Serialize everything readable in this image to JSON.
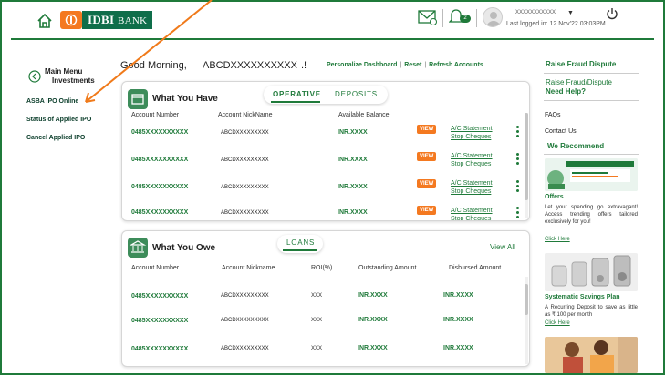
{
  "header": {
    "logo_text": "IDBI",
    "logo_suffix": "BANK",
    "notification_count": "2",
    "user_name": "XXXXXXXXXXX",
    "last_login": "Last logged in:  12 Nov'22 03:03PM"
  },
  "sidebar": {
    "main_menu": "Main Menu",
    "investments": "Investments",
    "items": [
      {
        "label": "ASBA IPO Online"
      },
      {
        "label": "Status of Applied IPO"
      },
      {
        "label": "Cancel Applied IPO"
      }
    ]
  },
  "greeting": {
    "text": "Good Morning,",
    "name": "ABCDXXXXXXXXXX",
    "suffix": ".!",
    "links": [
      "Personalize Dashboard",
      "Reset",
      "Refresh Accounts"
    ]
  },
  "have": {
    "title": "What You Have",
    "tabs": [
      "OPERATIVE",
      "DEPOSITS"
    ],
    "columns": [
      "Account Number",
      "Account NickName",
      "Available Balance"
    ],
    "view_label": "VIEW",
    "statement_label": "A/C Statement",
    "stop_label": "Stop Cheques",
    "rows": [
      {
        "account": "0485XXXXXXXXXX",
        "nickname": "ABCDXXXXXXXXX",
        "balance": "INR.XXXX"
      },
      {
        "account": "0485XXXXXXXXXX",
        "nickname": "ABCDXXXXXXXXX",
        "balance": "INR.XXXX"
      },
      {
        "account": "0485XXXXXXXXXX",
        "nickname": "ABCDXXXXXXXXX",
        "balance": "INR.XXXX"
      },
      {
        "account": "0485XXXXXXXXXX",
        "nickname": "ABCDXXXXXXXXX",
        "balance": "INR.XXXX"
      }
    ]
  },
  "owe": {
    "title": "What You Owe",
    "tab": "LOANS",
    "view_all": "View All",
    "columns": [
      "Account Number",
      "Account Nickname",
      "ROI(%)",
      "Outstanding Amount",
      "Disbursed Amount"
    ],
    "rows": [
      {
        "account": "0485XXXXXXXXXX",
        "nickname": "ABCDXXXXXXXXX",
        "roi": "XXX",
        "outstanding": "INR.XXXX",
        "disbursed": "INR.XXXX"
      },
      {
        "account": "0485XXXXXXXXXX",
        "nickname": "ABCDXXXXXXXXX",
        "roi": "XXX",
        "outstanding": "INR.XXXX",
        "disbursed": "INR.XXXX"
      },
      {
        "account": "0485XXXXXXXXXX",
        "nickname": "ABCDXXXXXXXXX",
        "roi": "XXX",
        "outstanding": "INR.XXXX",
        "disbursed": "INR.XXXX"
      }
    ]
  },
  "right": {
    "raise_dispute_title": "Raise Fraud Dispute",
    "raise_dispute_link": "Raise Fraud/Dispute",
    "need_help": "Need Help?",
    "faqs": "FAQs",
    "contact": "Contact Us",
    "recommend": "We Recommend",
    "offers_title": "Offers",
    "offers_text": "Let your spending go extravagant! Access trending offers tailored exclusively for you!",
    "click_here": "Click Here",
    "savings_title": "Systematic Savings Plan",
    "savings_text": "A Recurring Deposit to save as little as ₹ 100 per month"
  },
  "colors": {
    "brand_green": "#1f7a3a",
    "accent_orange": "#f47920",
    "annotation_arrow": "#f07a1a"
  }
}
